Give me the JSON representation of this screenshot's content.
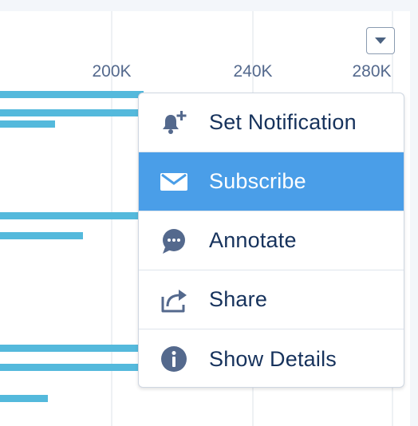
{
  "chart_data": {
    "type": "bar",
    "orientation": "horizontal",
    "x_tick_labels": [
      "200K",
      "240K",
      "280K"
    ],
    "x_ticks": [
      200000,
      240000,
      280000
    ],
    "series_color": "#54b9dc",
    "grid": true
  },
  "menu": {
    "toggle_icon": "chevron-down-icon",
    "selected_color": "#4a9ee8",
    "items": [
      {
        "label": "Set Notification",
        "icon": "bell-plus-icon",
        "selected": false
      },
      {
        "label": "Subscribe",
        "icon": "envelope-icon",
        "selected": true
      },
      {
        "label": "Annotate",
        "icon": "speech-bubble-icon",
        "selected": false
      },
      {
        "label": "Share",
        "icon": "share-icon",
        "selected": false
      },
      {
        "label": "Show Details",
        "icon": "info-icon",
        "selected": false
      }
    ]
  }
}
